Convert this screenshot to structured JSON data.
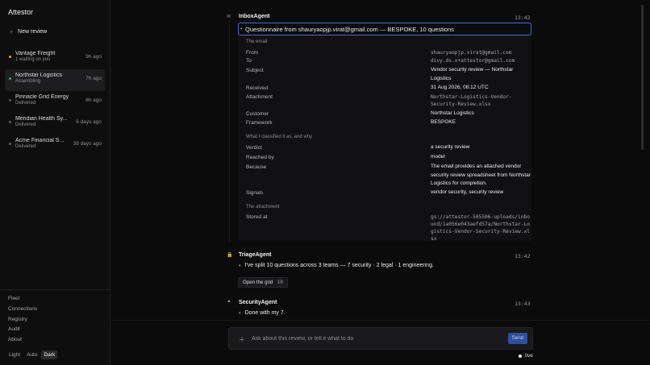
{
  "app": {
    "title": "Attestor"
  },
  "sidebar": {
    "new_review": {
      "icon": "plus-icon",
      "label": "New review"
    },
    "reviews": [
      {
        "name": "Vantage Freight",
        "status": "1 waiting on you",
        "age": "9h ago",
        "dot": "orange"
      },
      {
        "name": "Northstar Logistics",
        "status": "Assembling",
        "age": "7h ago",
        "dot": "green",
        "active": true
      },
      {
        "name": "Pinnacle Grid Energy",
        "status": "Delivered",
        "age": "8h ago",
        "dot": "grey"
      },
      {
        "name": "Meridian Health Sy...",
        "status": "Delivered",
        "age": "6 days ago",
        "dot": "grey"
      },
      {
        "name": "Acme Financial S...",
        "status": "Delivered",
        "age": "38 days ago",
        "dot": "grey"
      }
    ],
    "links": [
      "Fleet",
      "Connections",
      "Registry",
      "Audit",
      "About"
    ],
    "theme": {
      "options": [
        "Light",
        "Auto",
        "Dark"
      ],
      "selected": "Dark"
    }
  },
  "thread": {
    "inbox": {
      "agent": "InboxAgent",
      "time": "13:42",
      "icon": "mail-icon",
      "summary": "Questionnaire from shauryaopjp.virat@gmail.com — BESPOKE, 10 questions",
      "email_section": "The email",
      "email": {
        "from_label": "From",
        "from": "shauryaopjp.virat@gmail.com",
        "to_label": "To",
        "to": "divy.ds.x+attestor@gmail.com",
        "subject_label": "Subject",
        "subject": "Vendor security review — Northstar Logistics",
        "received_label": "Received",
        "received": "31 Aug 2026, 08:12 UTC",
        "attachment_label": "Attachment",
        "attachment": "Northstar-Logistics-Vendor-Security-Review.xlsx",
        "customer_label": "Customer",
        "customer": "Northstar Logistics",
        "framework_label": "Framework",
        "framework": "BESPOKE"
      },
      "classify_section": "What I classified it as, and why",
      "classify": {
        "verdict_label": "Verdict",
        "verdict": "a security review",
        "reached_label": "Reached by",
        "reached": "model",
        "because_label": "Because",
        "because": "The email provides an attached vendor security review spreadsheet from Northstar Logistics for completion.",
        "signals_label": "Signals",
        "signals": "vendor security, security review"
      },
      "attachment_section": "The attachment",
      "attachment_info": {
        "stored_label": "Stored at",
        "stored": "gs://attestor-505506-uploads/inbound/1a056e043aefd57a/Northstar-Logistics-Vendor-Security-Review.xlsx"
      }
    },
    "triage": {
      "agent": "TriageAgent",
      "time": "13:42",
      "icon": "lock-icon",
      "message": "I've split 10 questions across 3 teams — 7 security · 2 legal · 1 engineering.",
      "button_label": "Open the grid",
      "button_count": "10"
    },
    "security": {
      "agent": "SecurityAgent",
      "time": "13:43",
      "icon": "triangle-icon",
      "message": "Done with my 7."
    }
  },
  "composer": {
    "icon": "plus-icon",
    "placeholder": "Ask about this review, or tell it what to do",
    "send_label": "Send",
    "status": "live"
  }
}
